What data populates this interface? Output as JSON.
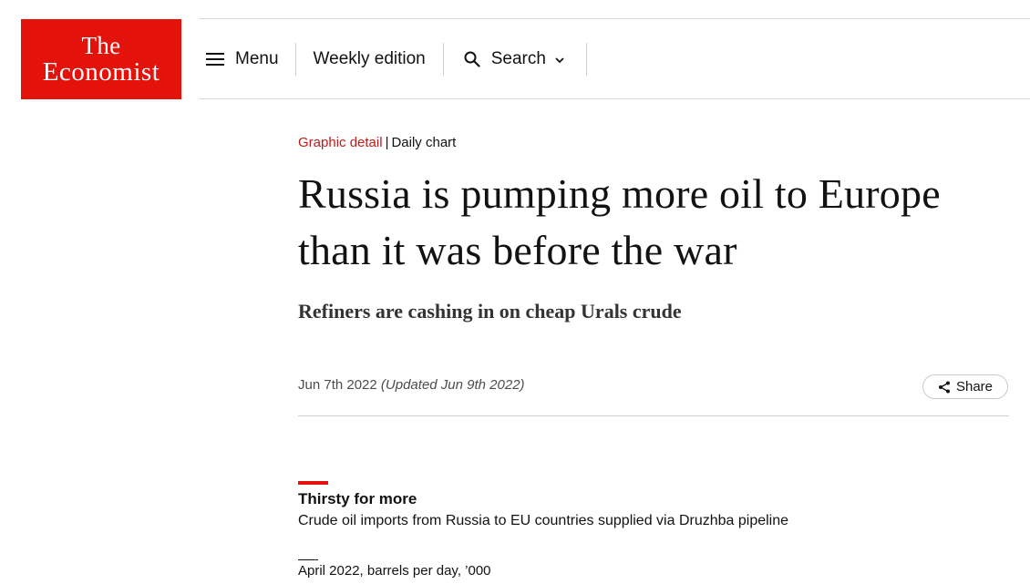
{
  "brand": {
    "logo_line1": "The",
    "logo_line2": "Economist",
    "color": "#e3120b"
  },
  "nav": {
    "menu_label": "Menu",
    "weekly_label": "Weekly edition",
    "search_label": "Search"
  },
  "article": {
    "section": "Graphic detail",
    "series": "Daily chart",
    "headline": "Russia is pumping more oil to Europe than it was before the war",
    "subheadline": "Refiners are cashing in on cheap Urals crude",
    "date": "Jun 7th 2022",
    "updated": "(Updated Jun 9th 2022)",
    "share_label": "Share",
    "section_color": "#c01b1b"
  },
  "chart_header": {
    "title": "Thirsty for more",
    "subtitle": "Crude oil imports from Russia to EU countries supplied via Druzhba pipeline",
    "unit": "April 2022, barrels per day, ’000"
  },
  "icons": {
    "menu": "hamburger-menu-icon",
    "search": "search-icon",
    "dropdown": "chevron-down-icon",
    "share": "share-icon"
  }
}
